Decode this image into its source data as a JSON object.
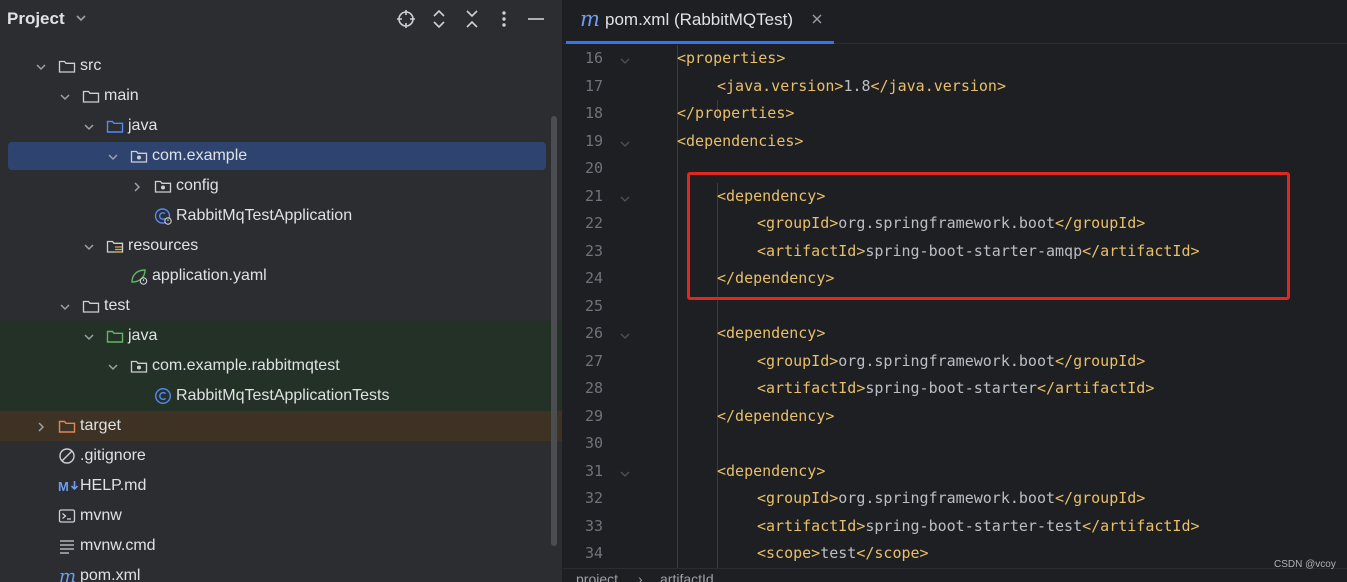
{
  "project_panel": {
    "title": "Project",
    "header_icons": [
      "target-icon",
      "expand-icon",
      "collapse-icon",
      "more-icon",
      "minimize-icon"
    ],
    "tree": [
      {
        "label": "src",
        "icon": "folder-icon",
        "chevron": "expanded"
      },
      {
        "label": "main",
        "icon": "folder-icon",
        "chevron": "expanded"
      },
      {
        "label": "java",
        "icon": "source-folder-icon",
        "chevron": "expanded"
      },
      {
        "label": "com.example",
        "icon": "package-icon",
        "chevron": "expanded",
        "selected": true
      },
      {
        "label": "config",
        "icon": "package-icon",
        "chevron": "collapsed"
      },
      {
        "label": "RabbitMqTestApplication",
        "icon": "spring-boot-class-icon",
        "chevron": "none"
      },
      {
        "label": "resources",
        "icon": "resources-folder-icon",
        "chevron": "expanded"
      },
      {
        "label": "application.yaml",
        "icon": "spring-config-icon",
        "chevron": "none"
      },
      {
        "label": "test",
        "icon": "folder-icon",
        "chevron": "expanded"
      },
      {
        "label": "java",
        "icon": "test-source-folder-icon",
        "chevron": "expanded",
        "background": "test"
      },
      {
        "label": "com.example.rabbitmqtest",
        "icon": "package-icon",
        "chevron": "expanded",
        "background": "test"
      },
      {
        "label": "RabbitMqTestApplicationTests",
        "icon": "class-icon",
        "chevron": "none",
        "background": "test"
      },
      {
        "label": "target",
        "icon": "excluded-folder-icon",
        "chevron": "collapsed",
        "background": "excluded"
      },
      {
        "label": ".gitignore",
        "icon": "ignore-file-icon",
        "chevron": "none"
      },
      {
        "label": "HELP.md",
        "icon": "markdown-icon",
        "chevron": "none"
      },
      {
        "label": "mvnw",
        "icon": "terminal-icon",
        "chevron": "none"
      },
      {
        "label": "mvnw.cmd",
        "icon": "text-file-icon",
        "chevron": "none"
      },
      {
        "label": "pom.xml",
        "icon": "maven-icon",
        "chevron": "none"
      }
    ]
  },
  "editor": {
    "tab": {
      "label": "pom.xml (RabbitMQTest)",
      "icon": "maven-icon"
    },
    "lines": [
      {
        "n": "16",
        "indent": 1,
        "fold": true,
        "parts": [
          [
            "tag",
            "<properties>"
          ]
        ]
      },
      {
        "n": "17",
        "indent": 2,
        "fold": false,
        "parts": [
          [
            "tag",
            "<java.version>"
          ],
          [
            "txt",
            "1.8"
          ],
          [
            "tag",
            "</java.version>"
          ]
        ]
      },
      {
        "n": "18",
        "indent": 1,
        "fold": false,
        "parts": [
          [
            "tag",
            "</properties>"
          ]
        ]
      },
      {
        "n": "19",
        "indent": 1,
        "fold": true,
        "parts": [
          [
            "tag",
            "<dependencies>"
          ]
        ]
      },
      {
        "n": "20",
        "indent": 0,
        "fold": false,
        "parts": []
      },
      {
        "n": "21",
        "indent": 2,
        "fold": true,
        "parts": [
          [
            "tag",
            "<dependency>"
          ]
        ]
      },
      {
        "n": "22",
        "indent": 3,
        "fold": false,
        "parts": [
          [
            "tag",
            "<groupId>"
          ],
          [
            "txt",
            "org.springframework.boot"
          ],
          [
            "tag",
            "</groupId>"
          ]
        ]
      },
      {
        "n": "23",
        "indent": 3,
        "fold": false,
        "parts": [
          [
            "tag",
            "<artifactId>"
          ],
          [
            "txt",
            "spring-boot-starter-amqp"
          ],
          [
            "tag",
            "</artifactId>"
          ]
        ]
      },
      {
        "n": "24",
        "indent": 2,
        "fold": false,
        "parts": [
          [
            "tag",
            "</dependency>"
          ]
        ]
      },
      {
        "n": "25",
        "indent": 0,
        "fold": false,
        "parts": []
      },
      {
        "n": "26",
        "indent": 2,
        "fold": true,
        "parts": [
          [
            "tag",
            "<dependency>"
          ]
        ]
      },
      {
        "n": "27",
        "indent": 3,
        "fold": false,
        "parts": [
          [
            "tag",
            "<groupId>"
          ],
          [
            "txt",
            "org.springframework.boot"
          ],
          [
            "tag",
            "</groupId>"
          ]
        ]
      },
      {
        "n": "28",
        "indent": 3,
        "fold": false,
        "parts": [
          [
            "tag",
            "<artifactId>"
          ],
          [
            "txt",
            "spring-boot-starter"
          ],
          [
            "tag",
            "</artifactId>"
          ]
        ]
      },
      {
        "n": "29",
        "indent": 2,
        "fold": false,
        "parts": [
          [
            "tag",
            "</dependency>"
          ]
        ]
      },
      {
        "n": "30",
        "indent": 0,
        "fold": false,
        "parts": []
      },
      {
        "n": "31",
        "indent": 2,
        "fold": true,
        "parts": [
          [
            "tag",
            "<dependency>"
          ]
        ]
      },
      {
        "n": "32",
        "indent": 3,
        "fold": false,
        "parts": [
          [
            "tag",
            "<groupId>"
          ],
          [
            "txt",
            "org.springframework.boot"
          ],
          [
            "tag",
            "</groupId>"
          ]
        ]
      },
      {
        "n": "33",
        "indent": 3,
        "fold": false,
        "parts": [
          [
            "tag",
            "<artifactId>"
          ],
          [
            "txt",
            "spring-boot-starter-test"
          ],
          [
            "tag",
            "</artifactId>"
          ]
        ]
      },
      {
        "n": "34",
        "indent": 3,
        "fold": false,
        "parts": [
          [
            "tag",
            "<scope>"
          ],
          [
            "txt",
            "test"
          ],
          [
            "tag",
            "</scope>"
          ]
        ]
      }
    ],
    "breadcrumbs": [
      "project",
      "artifactId"
    ]
  },
  "watermark": "CSDN @vcoy",
  "colors": {
    "tag": "#e8bf6a",
    "text": "#bcbec4",
    "selection": "#2e436e",
    "highlight_box": "#e0281e",
    "accent": "#3574f0"
  }
}
